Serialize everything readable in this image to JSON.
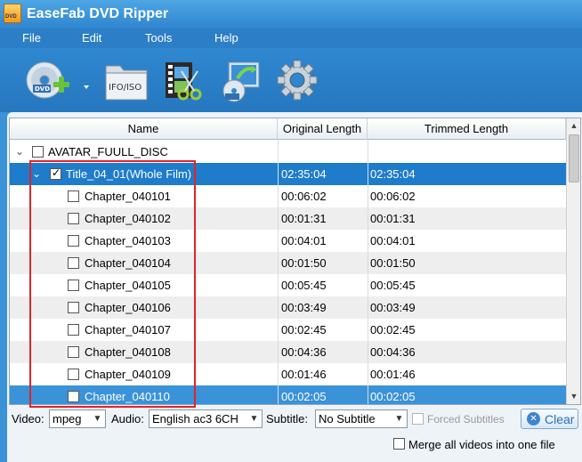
{
  "window": {
    "title": "EaseFab DVD Ripper",
    "app_icon_text": "DVD"
  },
  "menu": [
    "File",
    "Edit",
    "Tools",
    "Help"
  ],
  "toolbar": {
    "load_dvd": "dvd-disc-add-icon",
    "load_ifo": "IFO/ISO",
    "edit": "video-edit-icon",
    "convert": "dvd-copy-icon",
    "settings": "gear-icon"
  },
  "table": {
    "headers": {
      "name": "Name",
      "original": "Original Length",
      "trimmed": "Trimmed Length"
    },
    "disc": {
      "name": "AVATAR_FUULL_DISC",
      "checked": false
    },
    "title_row": {
      "name": "Title_04_01(Whole Film)",
      "original": "02:35:04",
      "trimmed": "02:35:04",
      "checked": true
    },
    "chapters": [
      {
        "name": "Chapter_040101",
        "original": "00:06:02",
        "trimmed": "00:06:02"
      },
      {
        "name": "Chapter_040102",
        "original": "00:01:31",
        "trimmed": "00:01:31"
      },
      {
        "name": "Chapter_040103",
        "original": "00:04:01",
        "trimmed": "00:04:01"
      },
      {
        "name": "Chapter_040104",
        "original": "00:01:50",
        "trimmed": "00:01:50"
      },
      {
        "name": "Chapter_040105",
        "original": "00:05:45",
        "trimmed": "00:05:45"
      },
      {
        "name": "Chapter_040106",
        "original": "00:03:49",
        "trimmed": "00:03:49"
      },
      {
        "name": "Chapter_040107",
        "original": "00:02:45",
        "trimmed": "00:02:45"
      },
      {
        "name": "Chapter_040108",
        "original": "00:04:36",
        "trimmed": "00:04:36"
      },
      {
        "name": "Chapter_040109",
        "original": "00:01:46",
        "trimmed": "00:01:46"
      },
      {
        "name": "Chapter_040110",
        "original": "00:02:05",
        "trimmed": "00:02:05"
      }
    ]
  },
  "options": {
    "video_label": "Video:",
    "video_value": "mpeg",
    "audio_label": "Audio:",
    "audio_value": "English ac3 6CH",
    "subtitle_label": "Subtitle:",
    "subtitle_value": "No Subtitle",
    "forced_subtitles": "Forced Subtitles",
    "clear_label": "Clear"
  },
  "merge": {
    "label": "Merge all videos into one file",
    "checked": false
  }
}
